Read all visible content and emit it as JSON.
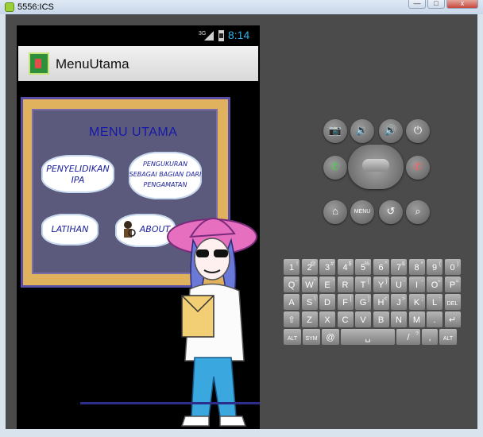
{
  "window": {
    "title": "5556:ICS",
    "controls": [
      "—",
      "□",
      "x"
    ]
  },
  "status_bar": {
    "network": "3G",
    "time": "8:14"
  },
  "app": {
    "title": "MenuUtama",
    "icon": "book-icon"
  },
  "menu": {
    "title": "MENU UTAMA",
    "items": [
      "PENYELIDIKAN IPA",
      "PENGUKURAN SEBAGAI BAGIAN DARI PENGAMATAN",
      "LATIHAN",
      "ABOUT"
    ]
  },
  "emulator_buttons": {
    "row1": [
      "camera-icon",
      "volume-down-icon",
      "volume-up-icon",
      "power-icon"
    ],
    "row2": [
      "call-icon",
      "end-call-icon"
    ],
    "row3": [
      "home-icon",
      "menu-button",
      "back-icon",
      "search-icon"
    ],
    "menu_label": "MENU"
  },
  "keyboard": {
    "row1": [
      {
        "k": "1",
        "s": "!"
      },
      {
        "k": "2",
        "s": "@"
      },
      {
        "k": "3",
        "s": "#"
      },
      {
        "k": "4",
        "s": "$"
      },
      {
        "k": "5",
        "s": "%"
      },
      {
        "k": "6",
        "s": "^"
      },
      {
        "k": "7",
        "s": "&"
      },
      {
        "k": "8",
        "s": "*"
      },
      {
        "k": "9",
        "s": "("
      },
      {
        "k": "0",
        "s": ")"
      }
    ],
    "row2": [
      {
        "k": "Q",
        "s": "~"
      },
      {
        "k": "W",
        "s": "\""
      },
      {
        "k": "E",
        "s": "'"
      },
      {
        "k": "R",
        "s": ""
      },
      {
        "k": "T",
        "s": "{"
      },
      {
        "k": "Y",
        "s": "}"
      },
      {
        "k": "U",
        "s": "-"
      },
      {
        "k": "I",
        "s": "-"
      },
      {
        "k": "O",
        "s": "+"
      },
      {
        "k": "P",
        "s": "="
      }
    ],
    "row3": [
      {
        "k": "A",
        "s": ""
      },
      {
        "k": "S",
        "s": "\\"
      },
      {
        "k": "D",
        "s": ""
      },
      {
        "k": "F",
        "s": "["
      },
      {
        "k": "G",
        "s": "]"
      },
      {
        "k": "H",
        "s": "<"
      },
      {
        "k": "J",
        "s": ">"
      },
      {
        "k": "K",
        "s": ";"
      },
      {
        "k": "L",
        "s": ":"
      },
      {
        "k": "DEL",
        "s": ""
      }
    ],
    "row4": [
      {
        "k": "⇧",
        "s": ""
      },
      {
        "k": "Z",
        "s": ""
      },
      {
        "k": "X",
        "s": ""
      },
      {
        "k": "C",
        "s": ""
      },
      {
        "k": "V",
        "s": ""
      },
      {
        "k": "B",
        "s": ""
      },
      {
        "k": "N",
        "s": ""
      },
      {
        "k": "M",
        "s": ""
      },
      {
        "k": ".",
        "s": ""
      },
      {
        "k": "↵",
        "s": ""
      }
    ],
    "row5": [
      {
        "k": "ALT",
        "s": ""
      },
      {
        "k": "SYM",
        "s": ""
      },
      {
        "k": "@",
        "s": ""
      },
      {
        "k": "␣",
        "s": ""
      },
      {
        "k": "/",
        "s": "?"
      },
      {
        "k": ",",
        "s": ""
      },
      {
        "k": "ALT",
        "s": ""
      }
    ]
  }
}
